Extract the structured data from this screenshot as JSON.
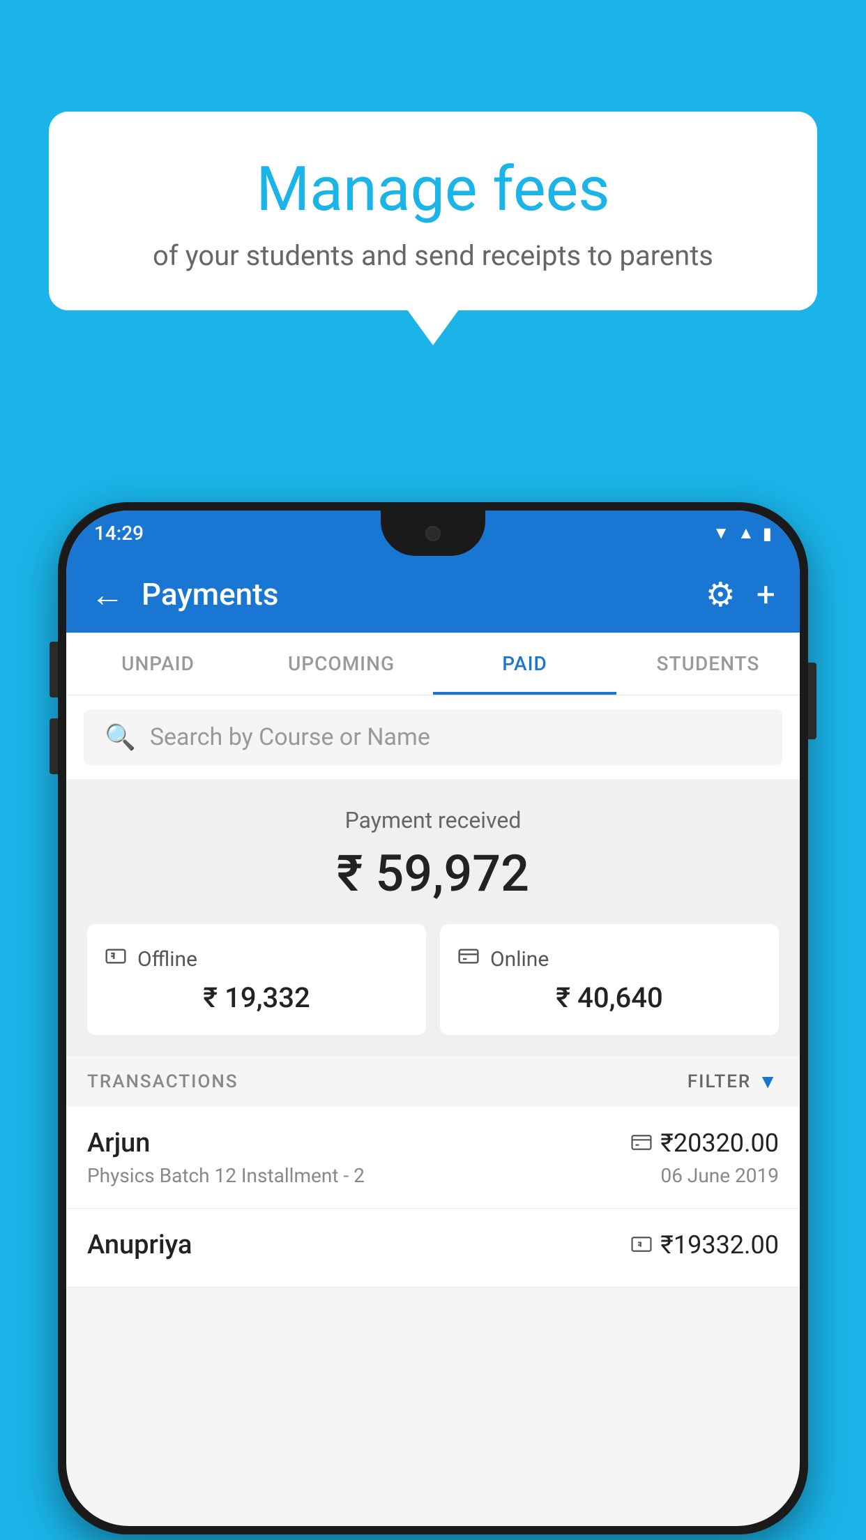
{
  "background_color": "#1ab4e8",
  "speech_bubble": {
    "title": "Manage fees",
    "subtitle": "of your students and send receipts to parents"
  },
  "status_bar": {
    "time": "14:29",
    "color": "#1976d2"
  },
  "app_bar": {
    "title": "Payments",
    "back_label": "←",
    "gear_label": "⚙",
    "plus_label": "+"
  },
  "tabs": [
    {
      "id": "unpaid",
      "label": "UNPAID",
      "active": false
    },
    {
      "id": "upcoming",
      "label": "UPCOMING",
      "active": false
    },
    {
      "id": "paid",
      "label": "PAID",
      "active": true
    },
    {
      "id": "students",
      "label": "STUDENTS",
      "active": false
    }
  ],
  "search": {
    "placeholder": "Search by Course or Name"
  },
  "payment_summary": {
    "label": "Payment received",
    "total_amount": "₹ 59,972",
    "offline": {
      "icon": "💳",
      "label": "Offline",
      "amount": "₹ 19,332"
    },
    "online": {
      "icon": "💳",
      "label": "Online",
      "amount": "₹ 40,640"
    }
  },
  "transactions": {
    "section_label": "TRANSACTIONS",
    "filter_label": "FILTER",
    "rows": [
      {
        "name": "Arjun",
        "course": "Physics Batch 12 Installment - 2",
        "date": "06 June 2019",
        "amount": "₹20320.00",
        "payment_type": "online"
      },
      {
        "name": "Anupriya",
        "course": "",
        "date": "",
        "amount": "₹19332.00",
        "payment_type": "offline"
      }
    ]
  }
}
